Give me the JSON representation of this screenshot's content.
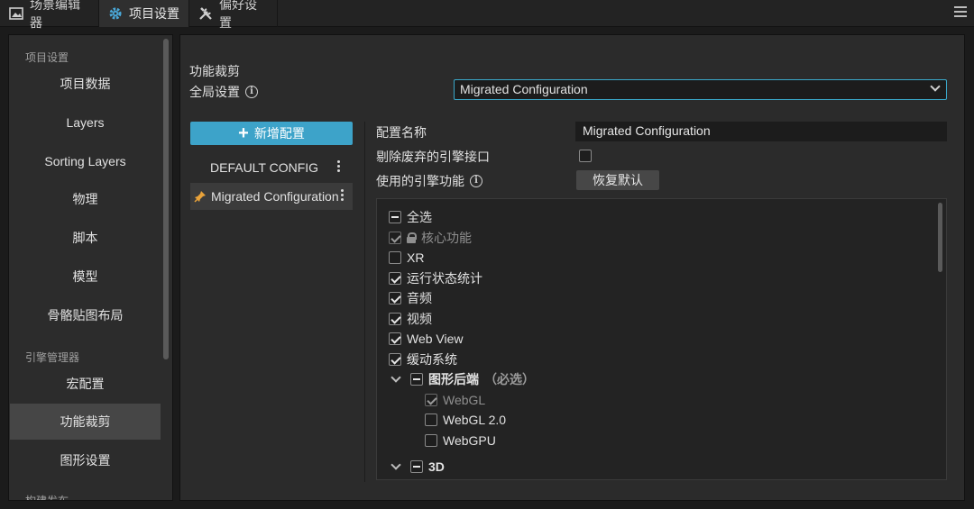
{
  "tabs": [
    {
      "label": "场景编辑器",
      "icon": "scene-icon"
    },
    {
      "label": "项目设置",
      "icon": "gear-icon",
      "active": true
    },
    {
      "label": "偏好设置",
      "icon": "tools-icon"
    }
  ],
  "sidebar": {
    "group1": "项目设置",
    "items1": [
      "项目数据",
      "Layers",
      "Sorting Layers",
      "物理",
      "脚本",
      "模型",
      "骨骼贴图布局"
    ],
    "group2": "引擎管理器",
    "items2": [
      "宏配置",
      "功能裁剪",
      "图形设置"
    ],
    "group3": "构建发布",
    "active_item": "功能裁剪"
  },
  "main": {
    "section_title": "功能裁剪",
    "global_label": "全局设置",
    "global_value": "Migrated Configuration",
    "add_button": "新增配置",
    "configs": [
      {
        "label": "DEFAULT CONFIG",
        "selected": false
      },
      {
        "label": "Migrated Configuration",
        "selected": true
      }
    ],
    "name_label": "配置名称",
    "name_value": "Migrated Configuration",
    "deprecated_label": "剔除废弃的引擎接口",
    "deprecated_checked": false,
    "features_label": "使用的引擎功能",
    "reset_button": "恢复默认",
    "features": {
      "select_all": "全选",
      "core": "核心功能",
      "xr": "XR",
      "profiler": "运行状态统计",
      "audio": "音频",
      "video": "视频",
      "webview": "Web View",
      "tween": "缓动系统",
      "gfx": "图形后端",
      "gfx_required": "（必选）",
      "webgl": "WebGL",
      "webgl2": "WebGL 2.0",
      "webgpu": "WebGPU",
      "next": "3D"
    }
  },
  "colors": {
    "accent": "#3da3c9",
    "active_nav": "#464646",
    "pin": "#e8a23a"
  }
}
